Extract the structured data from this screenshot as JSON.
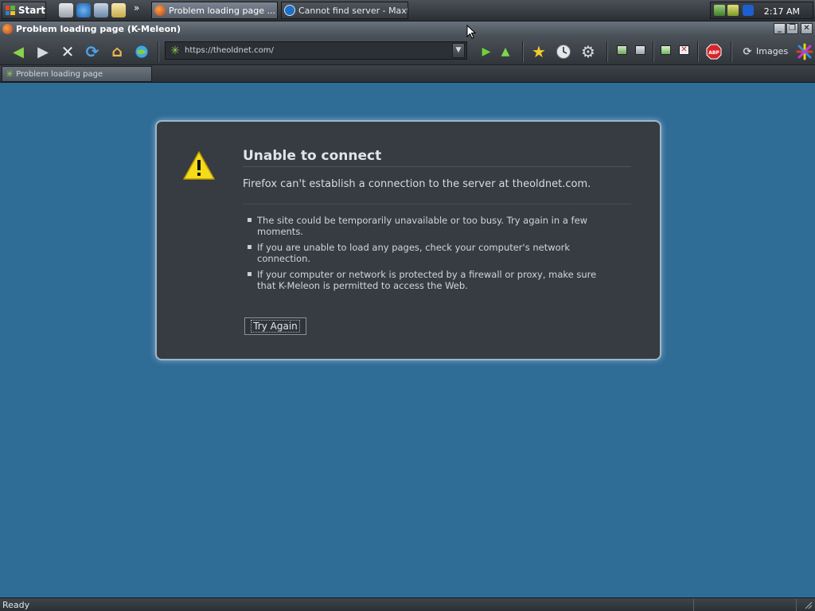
{
  "taskbar": {
    "start_label": "Start",
    "tasks": [
      {
        "label": "Problem loading page ..."
      },
      {
        "label": "Cannot find server - Maxt..."
      }
    ],
    "clock": "2:17 AM"
  },
  "window": {
    "title": "Problem loading page (K-Meleon)"
  },
  "toolbar": {
    "url": "https://theoldnet.com/",
    "images_label": "Images"
  },
  "tabs": [
    {
      "label": "Problem loading page"
    }
  ],
  "error": {
    "title": "Unable to connect",
    "description": "Firefox can't establish a connection to the server at theoldnet.com.",
    "bullets": [
      "The site could be temporarily unavailable or too busy. Try again in a few moments.",
      "If you are unable to load any pages, check your computer's network connection.",
      "If your computer or network is protected by a firewall or proxy, make sure that K-Meleon is permitted to access the Web."
    ],
    "try_again_label": "Try Again"
  },
  "status": {
    "text": "Ready"
  },
  "colors": {
    "background": "#2f6c96",
    "dialog": "#373c42",
    "dialog_border": "#9fb6c8"
  }
}
